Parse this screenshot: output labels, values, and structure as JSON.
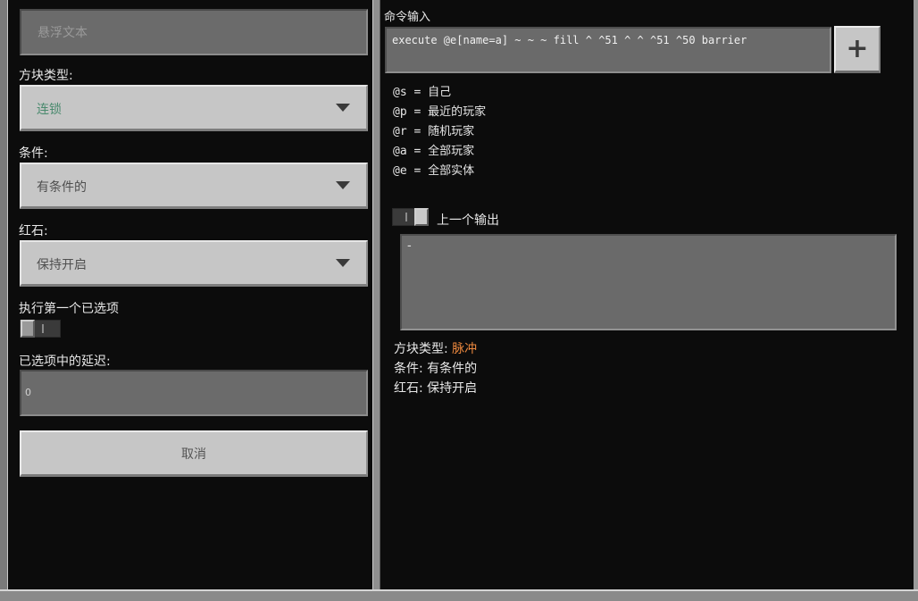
{
  "left": {
    "hover_text_placeholder": "悬浮文本",
    "block_type": {
      "label": "方块类型:",
      "value": "连锁"
    },
    "condition": {
      "label": "条件:",
      "value": "有条件的"
    },
    "redstone": {
      "label": "红石:",
      "value": "保持开启"
    },
    "execute_first": {
      "label": "执行第一个已选项"
    },
    "delay": {
      "label": "已选项中的延迟:",
      "value": "0"
    },
    "cancel_label": "取消"
  },
  "right": {
    "command_label": "命令输入",
    "command_value": "execute @e[name=a] ~ ~ ~ fill ^ ^51 ^ ^ ^51 ^50 barrier",
    "plus_label": "+",
    "selectors": [
      "@s = 自己",
      "@p = 最近的玩家",
      "@r = 随机玩家",
      "@a = 全部玩家",
      "@e = 全部实体"
    ],
    "previous_output": {
      "label": "上一个输出",
      "value": "-"
    },
    "info": {
      "block_type_label": "方块类型:",
      "block_type_value": "脉冲",
      "condition_line": "条件: 有条件的",
      "redstone_line": "红石: 保持开启"
    }
  },
  "colors": {
    "panel_bg": "#0c0c0c",
    "field_bg": "#6a6a6a",
    "button_bg": "#c6c6c6",
    "accent_orange": "#ef8a3f"
  }
}
